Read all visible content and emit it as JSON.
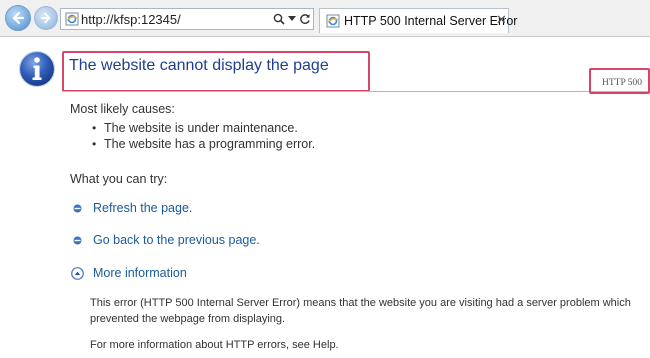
{
  "browser": {
    "url": "http://kfsp:12345/",
    "tab_title": "HTTP 500 Internal Server Error",
    "tab_close": "✕"
  },
  "page": {
    "title": "The website cannot display the page",
    "http_code": "HTTP 500",
    "causes_heading": "Most likely causes:",
    "causes": [
      "The website is under maintenance.",
      "The website has a programming error."
    ],
    "try_heading": "What you can try:",
    "actions": [
      "Refresh the page.",
      "Go back to the previous page."
    ],
    "more_info_label": "More information",
    "more_info_lines": [
      "This error (HTTP 500 Internal Server Error) means that the website you are visiting had a server problem which",
      "prevented the webpage from displaying."
    ],
    "help_line": "For more information about HTTP errors, see Help."
  },
  "colors": {
    "highlight_box": "#d8456a",
    "title": "#1f3f8e",
    "link": "#1a5b9e"
  }
}
